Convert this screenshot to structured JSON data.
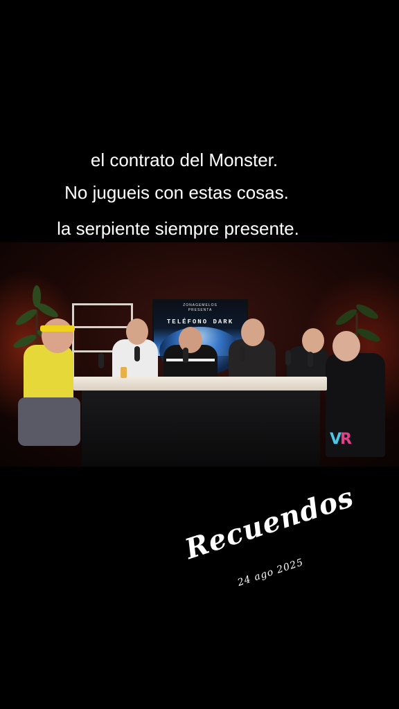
{
  "captions": [
    "el contrato del Monster.",
    "No jugueis con estas cosas.",
    "la serpiente siempre presente."
  ],
  "video": {
    "screen_brand_line1": "ZONAGEMELOS",
    "screen_brand_line2": "PRESENTA",
    "screen_title": "TELÉFONO DARK",
    "watermark_v": "V",
    "watermark_r": "R"
  },
  "overlay": {
    "title": "Recuendos",
    "date": "24 ago 2025"
  }
}
